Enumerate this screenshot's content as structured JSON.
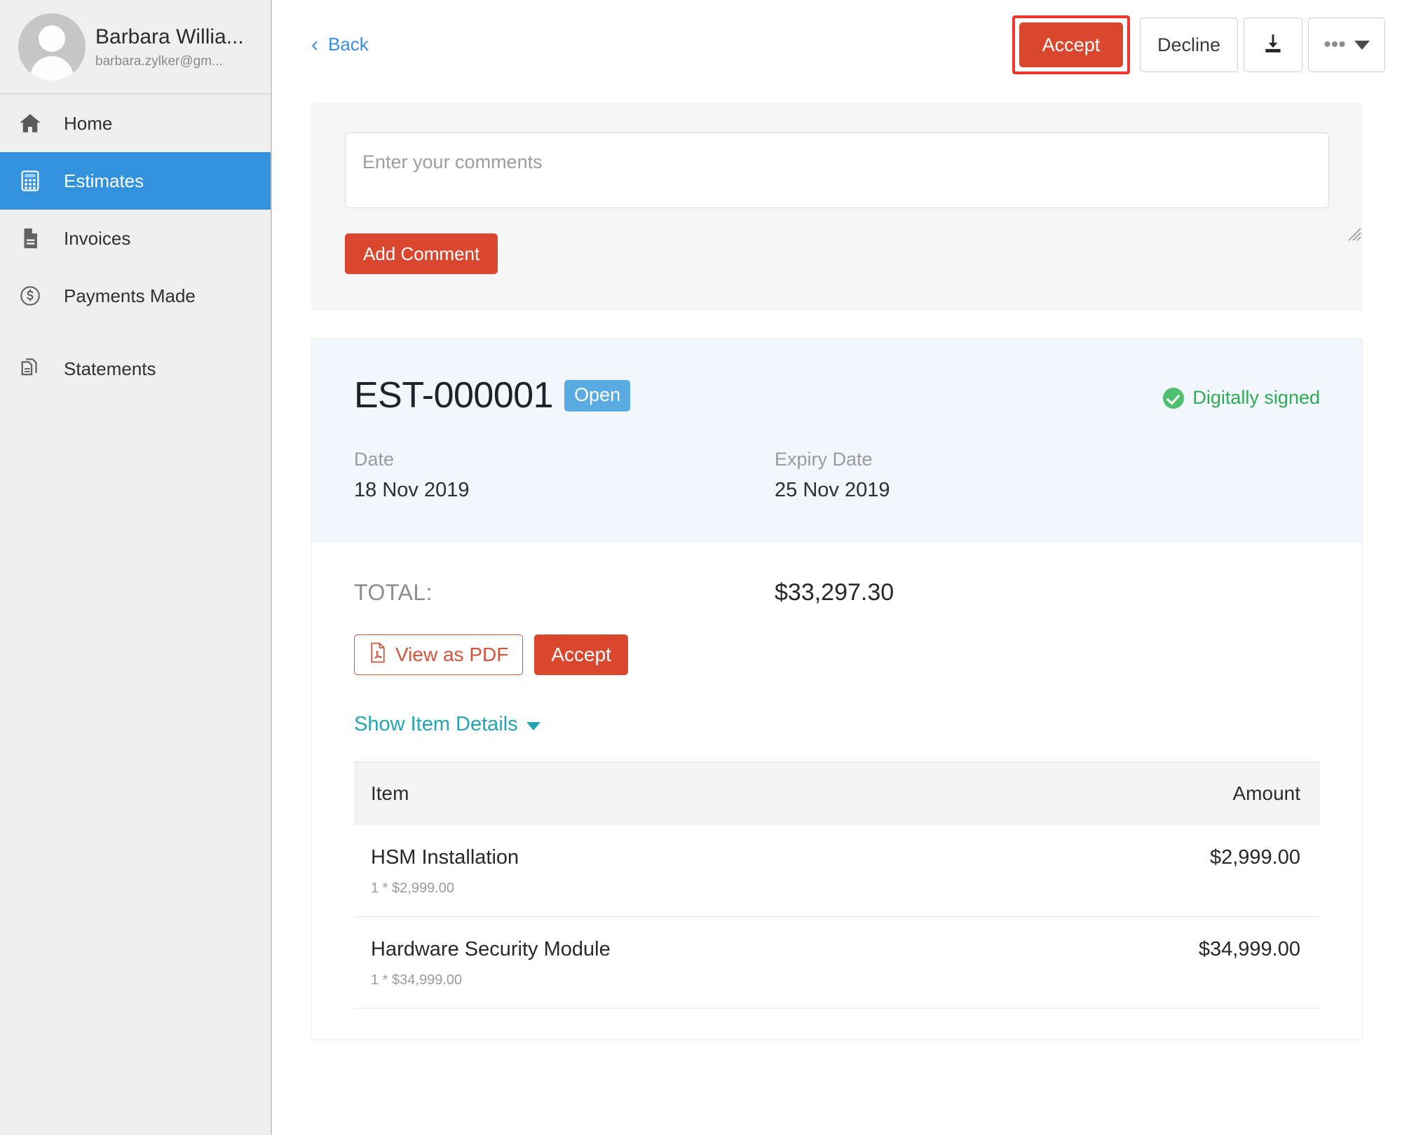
{
  "sidebar": {
    "profile": {
      "name": "Barbara Willia...",
      "email": "barbara.zylker@gm..."
    },
    "items": [
      {
        "label": "Home",
        "icon": "home-icon",
        "active": false
      },
      {
        "label": "Estimates",
        "icon": "calculator-icon",
        "active": true
      },
      {
        "label": "Invoices",
        "icon": "document-icon",
        "active": false
      },
      {
        "label": "Payments Made",
        "icon": "dollar-circle-icon",
        "active": false
      },
      {
        "label": "Statements",
        "icon": "documents-stack-icon",
        "active": false
      }
    ]
  },
  "topbar": {
    "back_label": "Back",
    "accept_label": "Accept",
    "decline_label": "Decline",
    "download_icon": "download-icon",
    "more_label": "•••"
  },
  "comments": {
    "placeholder": "Enter your comments",
    "value": "",
    "add_label": "Add Comment"
  },
  "estimate": {
    "number": "EST-000001",
    "status": "Open",
    "signed_label": "Digitally signed",
    "date_label": "Date",
    "date_value": "18 Nov 2019",
    "expiry_label": "Expiry Date",
    "expiry_value": "25 Nov 2019",
    "total_label": "TOTAL:",
    "total_value": "$33,297.30",
    "view_pdf_label": "View as PDF",
    "accept_label": "Accept",
    "show_details_label": "Show Item Details",
    "table": {
      "columns": [
        "Item",
        "Amount"
      ],
      "rows": [
        {
          "name": "HSM Installation",
          "amount": "$2,999.00",
          "sub": "1 * $2,999.00"
        },
        {
          "name": "Hardware Security Module",
          "amount": "$34,999.00",
          "sub": "1 * $34,999.00"
        }
      ]
    }
  },
  "colors": {
    "accent_red": "#d9472e",
    "highlight_red": "#f0352a",
    "nav_active_blue": "#3292dd",
    "badge_blue": "#5babe3",
    "signed_green": "#2faa55",
    "link_blue": "#3c8edd",
    "link_teal": "#24a4b5"
  }
}
